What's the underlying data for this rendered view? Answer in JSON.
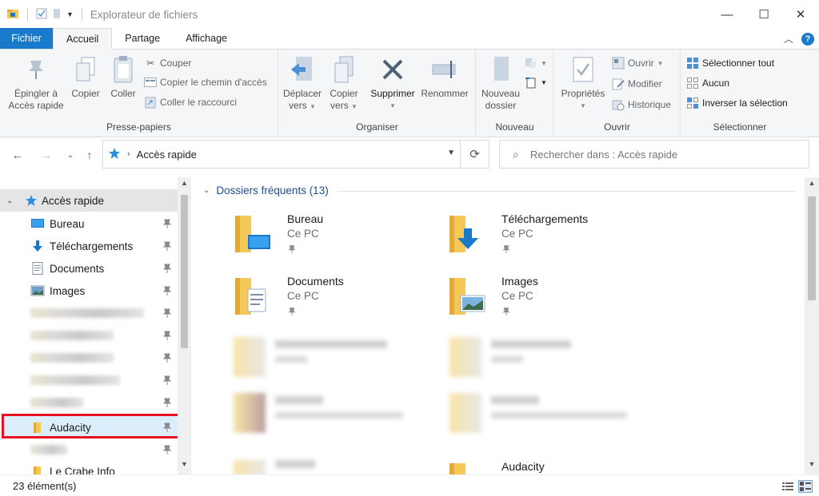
{
  "window": {
    "title": "Explorateur de fichiers"
  },
  "tabs": {
    "file": "Fichier",
    "home": "Accueil",
    "share": "Partage",
    "view": "Affichage"
  },
  "ribbon": {
    "clipboard": {
      "label": "Presse-papiers",
      "pin_l1": "Épingler à",
      "pin_l2": "Accès rapide",
      "copy": "Copier",
      "paste": "Coller",
      "cut": "Couper",
      "copy_path": "Copier le chemin d'accès",
      "paste_shortcut": "Coller le raccourci"
    },
    "organize": {
      "label": "Organiser",
      "move_l1": "Déplacer",
      "move_l2": "vers",
      "copy_l1": "Copier",
      "copy_l2": "vers",
      "delete": "Supprimer",
      "rename": "Renommer"
    },
    "new": {
      "label": "Nouveau",
      "folder_l1": "Nouveau",
      "folder_l2": "dossier"
    },
    "open": {
      "label": "Ouvrir",
      "properties": "Propriétés",
      "open": "Ouvrir",
      "edit": "Modifier",
      "history": "Historique"
    },
    "select": {
      "label": "Sélectionner",
      "all": "Sélectionner tout",
      "none": "Aucun",
      "invert": "Inverser la sélection"
    }
  },
  "address": {
    "path": "Accès rapide"
  },
  "search": {
    "placeholder": "Rechercher dans : Accès rapide"
  },
  "nav": {
    "quick_access": "Accès rapide",
    "items": [
      "Bureau",
      "Téléchargements",
      "Documents",
      "Images",
      "Audacity",
      "Le Crabe Info"
    ]
  },
  "content": {
    "section": "Dossiers fréquents (13)",
    "tiles": [
      {
        "name": "Bureau",
        "location": "Ce PC"
      },
      {
        "name": "Téléchargements",
        "location": "Ce PC"
      },
      {
        "name": "Documents",
        "location": "Ce PC"
      },
      {
        "name": "Images",
        "location": "Ce PC"
      },
      {
        "name": "Audacity",
        "location": ""
      }
    ]
  },
  "status": {
    "count": "23 élément(s)"
  },
  "colors": {
    "accent": "#1979ca",
    "highlight": "#e81123",
    "folder": "#f5c85a"
  }
}
